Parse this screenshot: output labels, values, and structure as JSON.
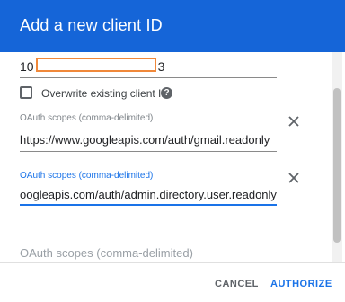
{
  "dialog": {
    "title": "Add a new client ID",
    "client_id": {
      "prefix": "10",
      "suffix": "3"
    },
    "overwrite_checkbox": {
      "label": "Overwrite existing client ID",
      "checked": false
    },
    "help_icon_glyph": "?",
    "scope_fields": [
      {
        "label": "OAuth scopes (comma-delimited)",
        "value": "https://www.googleapis.com/auth/gmail.readonly",
        "focused": false
      },
      {
        "label": "OAuth scopes (comma-delimited)",
        "value": "oogleapis.com/auth/admin.directory.user.readonly",
        "focused": true
      },
      {
        "placeholder": "OAuth scopes (comma-delimited)",
        "value": ""
      }
    ],
    "buttons": {
      "cancel": "CANCEL",
      "authorize": "AUTHORIZE"
    },
    "colors": {
      "header": "#1565d8",
      "accent": "#1a73e8",
      "redaction": "#f0883a"
    },
    "icons": [
      "help-icon",
      "close-icon"
    ]
  }
}
